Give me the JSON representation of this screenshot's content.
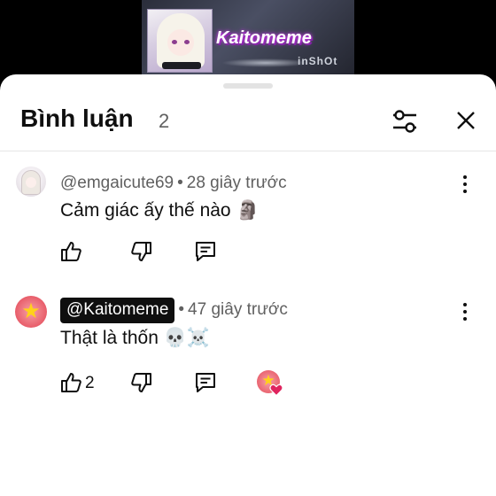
{
  "video": {
    "title": "Kaitomeme",
    "watermark": "inShOt"
  },
  "header": {
    "title": "Bình luận",
    "count": "2",
    "filter_icon": "sliders-icon",
    "close_icon": "close-icon"
  },
  "comments": [
    {
      "handle": "@emgaicute69",
      "time": "28 giây trước",
      "text": "Cảm giác ấy thế nào 🗿",
      "likes": "",
      "pinned_handle": false
    },
    {
      "handle": "@Kaitomeme",
      "time": "47 giây trước",
      "text": "Thật là thốn 💀☠️",
      "likes": "2",
      "pinned_handle": true,
      "creator_hearted": true
    }
  ],
  "colors": {
    "text_primary": "#0f0f0f",
    "text_secondary": "#606060",
    "heart": "#e0245e"
  }
}
